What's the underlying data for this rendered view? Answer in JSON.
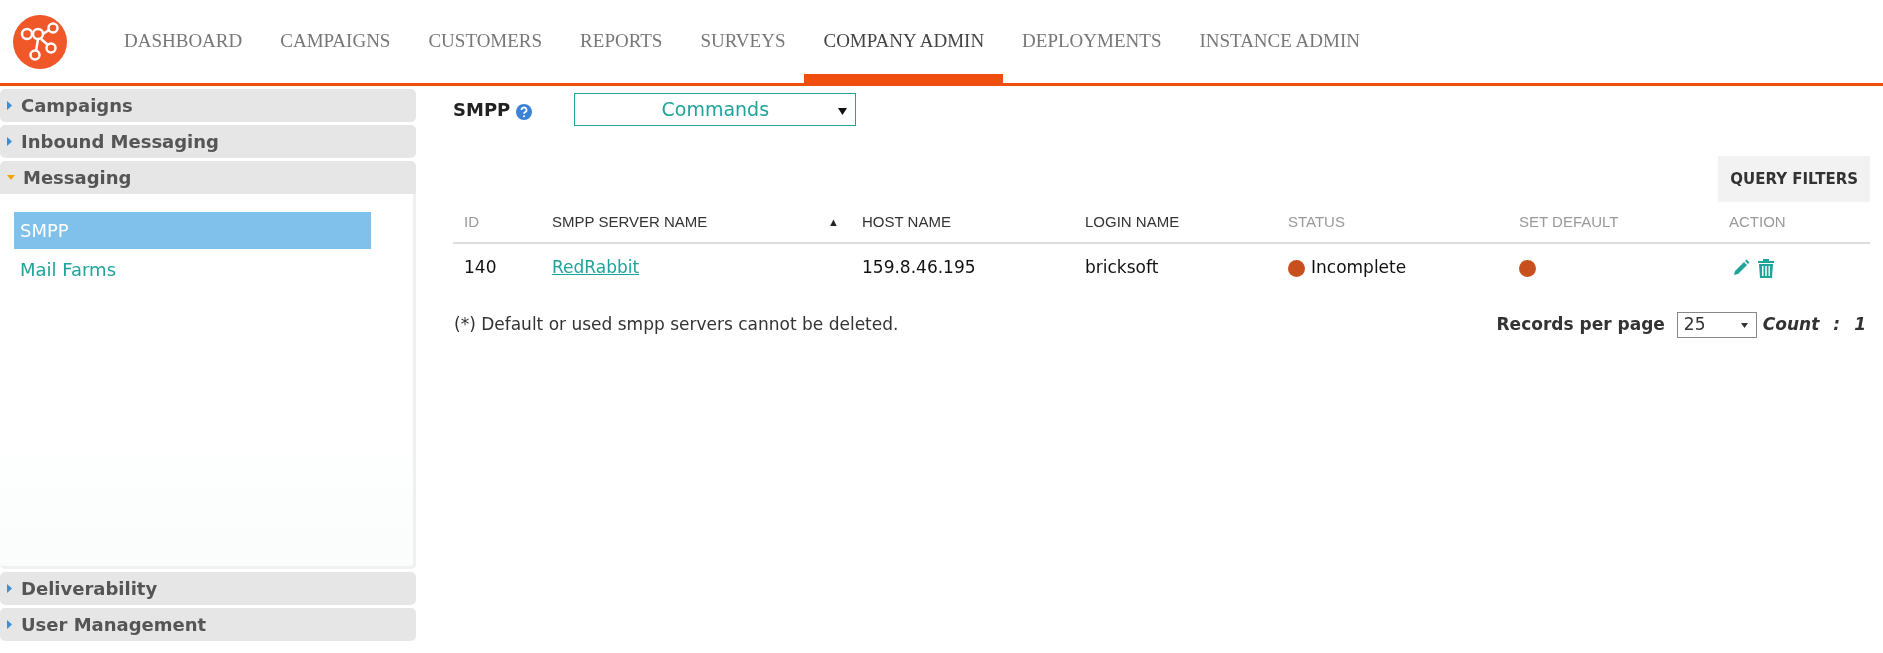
{
  "nav": [
    {
      "label": "DASHBOARD",
      "selected": false
    },
    {
      "label": "CAMPAIGNS",
      "selected": false
    },
    {
      "label": "CUSTOMERS",
      "selected": false
    },
    {
      "label": "REPORTS",
      "selected": false
    },
    {
      "label": "SURVEYS",
      "selected": false
    },
    {
      "label": "COMPANY ADMIN",
      "selected": true
    },
    {
      "label": "DEPLOYMENTS",
      "selected": false
    },
    {
      "label": "INSTANCE ADMIN",
      "selected": false
    }
  ],
  "sidebar": {
    "sections_top": [
      {
        "label": "Campaigns",
        "expanded": false
      },
      {
        "label": "Inbound Messaging",
        "expanded": false
      },
      {
        "label": "Messaging",
        "expanded": true,
        "children": [
          {
            "label": "SMPP",
            "selected": true
          },
          {
            "label": "Mail Farms",
            "selected": false
          }
        ]
      }
    ],
    "sections_bottom": [
      {
        "label": "Deliverability",
        "expanded": false
      },
      {
        "label": "User Management",
        "expanded": false
      }
    ]
  },
  "page_title": "SMPP",
  "commands_select": {
    "value": "Commands"
  },
  "query_filters_button": "QUERY FILTERS",
  "table": {
    "columns": [
      {
        "label": "ID",
        "sortable": false
      },
      {
        "label": "SMPP SERVER NAME",
        "sortable": true,
        "sort_glyph": "▲"
      },
      {
        "label": "HOST NAME",
        "sortable": true
      },
      {
        "label": "LOGIN NAME",
        "sortable": true
      },
      {
        "label": "STATUS",
        "sortable": false
      },
      {
        "label": "SET DEFAULT",
        "sortable": false
      },
      {
        "label": "ACTION",
        "sortable": false
      }
    ],
    "rows": [
      {
        "id": "140",
        "name": "RedRabbit",
        "host": "159.8.46.195",
        "login": "bricksoft",
        "status": "Incomplete",
        "status_dot": {
          "color": "#c8501e"
        },
        "default_dot": {
          "color": "#c8501e"
        }
      }
    ]
  },
  "footnote": "(*) Default or used smpp servers cannot be deleted.",
  "pagination": {
    "label": "Records per page",
    "value": "25",
    "count_label": "Count",
    "count_sep": ":",
    "count": "1"
  }
}
